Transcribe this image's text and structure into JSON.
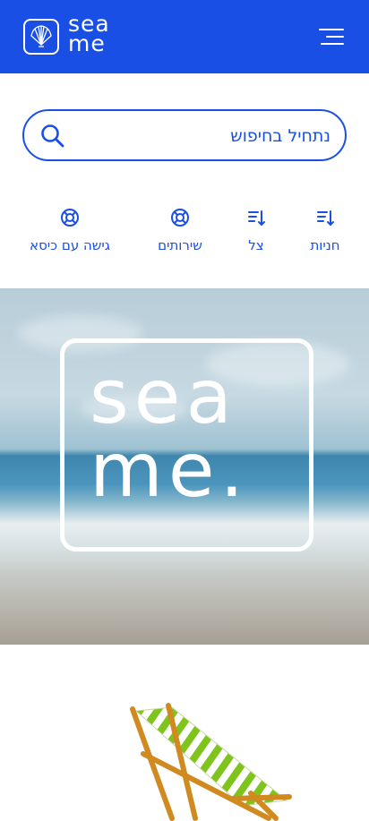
{
  "header": {
    "logo_line1": "sea",
    "logo_line2": "me",
    "menu_icon": "hamburger-menu-icon",
    "brand_color": "#1a4fe6"
  },
  "search": {
    "placeholder": "נתחיל בחיפוש",
    "icon": "search-icon"
  },
  "categories": [
    {
      "label": "חניות",
      "icon": "sort-list-icon"
    },
    {
      "label": "צל",
      "icon": "sort-list-icon"
    },
    {
      "label": "שירותים",
      "icon": "lifebuoy-icon"
    },
    {
      "label": "גישה עם כיסא",
      "icon": "lifebuoy-icon"
    }
  ],
  "hero": {
    "line1": "sea",
    "line2": "me."
  },
  "illustration": {
    "icon": "beach-chair-icon"
  }
}
